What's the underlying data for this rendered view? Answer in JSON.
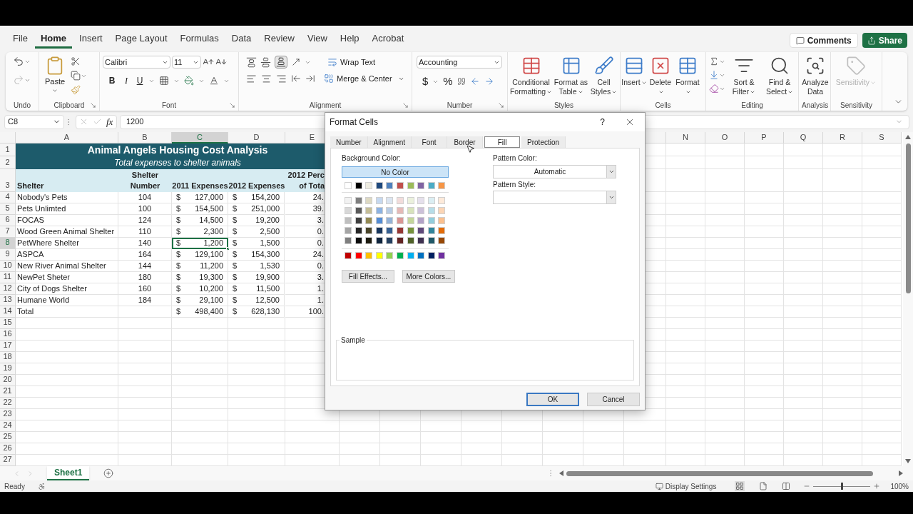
{
  "menu_tabs": [
    {
      "label": "File",
      "selected": false
    },
    {
      "label": "Home",
      "selected": true
    },
    {
      "label": "Insert",
      "selected": false
    },
    {
      "label": "Page Layout",
      "selected": false
    },
    {
      "label": "Formulas",
      "selected": false
    },
    {
      "label": "Data",
      "selected": false
    },
    {
      "label": "Review",
      "selected": false
    },
    {
      "label": "View",
      "selected": false
    },
    {
      "label": "Help",
      "selected": false
    },
    {
      "label": "Acrobat",
      "selected": false
    }
  ],
  "top_buttons": {
    "comments": "Comments",
    "share": "Share"
  },
  "ribbon": {
    "undo": {
      "label": "Undo"
    },
    "clipboard": {
      "label": "Clipboard",
      "paste": "Paste"
    },
    "font": {
      "label": "Font",
      "family": "Calibri",
      "size": "11",
      "bold": "B",
      "italic": "I",
      "underline": "U"
    },
    "alignment": {
      "label": "Alignment",
      "wrap_text": "Wrap Text",
      "merge": "Merge & Center"
    },
    "number": {
      "label": "Number",
      "format": "Accounting",
      "currency": "$",
      "percent": "%"
    },
    "styles": {
      "label": "Styles",
      "buttons": [
        {
          "kind": "conditional",
          "text": "Conditional Formatting"
        },
        {
          "kind": "table",
          "text": "Format as Table"
        },
        {
          "kind": "cellstyles",
          "text": "Cell Styles"
        }
      ]
    },
    "cells": {
      "label": "Cells",
      "buttons": [
        {
          "kind": "insert",
          "text": "Insert"
        },
        {
          "kind": "delete",
          "text": "Delete"
        },
        {
          "kind": "format",
          "text": "Format"
        }
      ]
    },
    "editing": {
      "label": "Editing",
      "buttons": [
        {
          "kind": "sort",
          "text": "Sort & Filter"
        },
        {
          "kind": "find",
          "text": "Find & Select"
        }
      ]
    },
    "analysis": {
      "label": "Analysis",
      "button": {
        "text": "Analyze Data"
      }
    },
    "sensitivity": {
      "label": "Sensitivity",
      "button": {
        "text": "Sensitivity",
        "disabled": true
      }
    }
  },
  "formula_bar": {
    "name_box": "C8",
    "function_label": "fx",
    "value": "1200"
  },
  "sheet": {
    "columns_left": [
      {
        "label": "A",
        "selected": false
      },
      {
        "label": "B",
        "selected": false
      },
      {
        "label": "C",
        "selected": true
      },
      {
        "label": "D",
        "selected": false
      },
      {
        "label": "E",
        "selected": false
      }
    ],
    "columns_right": [
      {
        "label": "N",
        "selected": false
      },
      {
        "label": "O",
        "selected": false
      },
      {
        "label": "P",
        "selected": false
      },
      {
        "label": "Q",
        "selected": false
      },
      {
        "label": "R",
        "selected": false
      },
      {
        "label": "S",
        "selected": false
      }
    ],
    "row_headers": [
      {
        "label": "1",
        "selected": false
      },
      {
        "label": "2",
        "selected": false
      },
      {
        "label": "3",
        "selected": false
      },
      {
        "label": "4",
        "selected": false
      },
      {
        "label": "5",
        "selected": false
      },
      {
        "label": "6",
        "selected": false
      },
      {
        "label": "7",
        "selected": false
      },
      {
        "label": "8",
        "selected": true
      },
      {
        "label": "9",
        "selected": false
      },
      {
        "label": "10",
        "selected": false
      },
      {
        "label": "11",
        "selected": false
      },
      {
        "label": "12",
        "selected": false
      },
      {
        "label": "13",
        "selected": false
      },
      {
        "label": "14",
        "selected": false
      },
      {
        "label": "15",
        "selected": false
      },
      {
        "label": "16",
        "selected": false
      },
      {
        "label": "17",
        "selected": false
      },
      {
        "label": "18",
        "selected": false
      },
      {
        "label": "19",
        "selected": false
      },
      {
        "label": "20",
        "selected": false
      },
      {
        "label": "21",
        "selected": false
      },
      {
        "label": "22",
        "selected": false
      },
      {
        "label": "23",
        "selected": false
      },
      {
        "label": "24",
        "selected": false
      },
      {
        "label": "25",
        "selected": false
      },
      {
        "label": "26",
        "selected": false
      },
      {
        "label": "27",
        "selected": false
      }
    ],
    "title": "Animal Angels Housing Cost Analysis",
    "subtitle": "Total expenses to shelter animals",
    "header": [
      [
        "Shelter"
      ],
      [
        "Shelter",
        "Number"
      ],
      [
        "2011 Expenses"
      ],
      [
        "2012 Expenses"
      ],
      [
        "2012 Perc",
        "of Tota"
      ]
    ],
    "rows": [
      {
        "shelter": "Nobody's Pets",
        "number": "104",
        "exp_2011": {
          "symbol": "$",
          "amount": "127,000",
          "selected": false
        },
        "exp_2012": {
          "symbol": "$",
          "amount": "154,200",
          "selected": false
        },
        "percent": "24."
      },
      {
        "shelter": "Pets Unlimted",
        "number": "100",
        "exp_2011": {
          "symbol": "$",
          "amount": "154,500",
          "selected": false
        },
        "exp_2012": {
          "symbol": "$",
          "amount": "251,000",
          "selected": false
        },
        "percent": "39."
      },
      {
        "shelter": "FOCAS",
        "number": "124",
        "exp_2011": {
          "symbol": "$",
          "amount": "14,500",
          "selected": false
        },
        "exp_2012": {
          "symbol": "$",
          "amount": "19,200",
          "selected": false
        },
        "percent": "3."
      },
      {
        "shelter": "Wood Green Animal Shelter",
        "number": "110",
        "exp_2011": {
          "symbol": "$",
          "amount": "2,300",
          "selected": false
        },
        "exp_2012": {
          "symbol": "$",
          "amount": "2,500",
          "selected": false
        },
        "percent": "0."
      },
      {
        "shelter": "PetWhere Shelter",
        "number": "140",
        "exp_2011": {
          "symbol": "$",
          "amount": "1,200",
          "selected": true
        },
        "exp_2012": {
          "symbol": "$",
          "amount": "1,500",
          "selected": false
        },
        "percent": "0."
      },
      {
        "shelter": "ASPCA",
        "number": "164",
        "exp_2011": {
          "symbol": "$",
          "amount": "129,100",
          "selected": false
        },
        "exp_2012": {
          "symbol": "$",
          "amount": "154,300",
          "selected": false
        },
        "percent": "24."
      },
      {
        "shelter": "New River Animal Shelter",
        "number": "144",
        "exp_2011": {
          "symbol": "$",
          "amount": "11,200",
          "selected": false
        },
        "exp_2012": {
          "symbol": "$",
          "amount": "1,530",
          "selected": false
        },
        "percent": "0."
      },
      {
        "shelter": "NewPet Sheter",
        "number": "180",
        "exp_2011": {
          "symbol": "$",
          "amount": "19,300",
          "selected": false
        },
        "exp_2012": {
          "symbol": "$",
          "amount": "19,900",
          "selected": false
        },
        "percent": "3."
      },
      {
        "shelter": "City of Dogs Shelter",
        "number": "160",
        "exp_2011": {
          "symbol": "$",
          "amount": "10,200",
          "selected": false
        },
        "exp_2012": {
          "symbol": "$",
          "amount": "11,500",
          "selected": false
        },
        "percent": "1."
      },
      {
        "shelter": "Humane World",
        "number": "184",
        "exp_2011": {
          "symbol": "$",
          "amount": "29,100",
          "selected": false
        },
        "exp_2012": {
          "symbol": "$",
          "amount": "12,500",
          "selected": false
        },
        "percent": "1."
      },
      {
        "shelter": "Total",
        "exp_2011": {
          "symbol": "$",
          "amount": "498,400",
          "selected": false
        },
        "exp_2012": {
          "symbol": "$",
          "amount": "628,130",
          "selected": false
        },
        "percent": "100."
      }
    ]
  },
  "sheet_tabs": [
    {
      "label": "Sheet1",
      "selected": true
    }
  ],
  "status_bar": {
    "ready": "Ready",
    "display_settings": "Display Settings",
    "zoom": {
      "level": 0.5
    },
    "zoom_label": "100%"
  },
  "dialog": {
    "title": "Format Cells",
    "help": "?",
    "tabs": [
      {
        "label": "Number",
        "selected": false
      },
      {
        "label": "Alignment",
        "selected": false
      },
      {
        "label": "Font",
        "selected": false
      },
      {
        "label": "Border",
        "selected": false
      },
      {
        "label": "Fill",
        "selected": true
      },
      {
        "label": "Protection",
        "selected": false
      }
    ],
    "background_label": "Background Color:",
    "no_color": {
      "label": "No Color",
      "selected": true
    },
    "theme_colors": [
      {
        "color": "#ffffff",
        "selected": false
      },
      {
        "color": "#000000",
        "selected": false
      },
      {
        "color": "#eeece1",
        "selected": false
      },
      {
        "color": "#1f497d",
        "selected": false
      },
      {
        "color": "#4f81bd",
        "selected": false
      },
      {
        "color": "#c0504d",
        "selected": false
      },
      {
        "color": "#9bbb59",
        "selected": false
      },
      {
        "color": "#8064a2",
        "selected": false
      },
      {
        "color": "#4bacc6",
        "selected": false
      },
      {
        "color": "#f79646",
        "selected": false
      }
    ],
    "tint_rows": [
      [
        {
          "color": "#f2f2f2",
          "selected": false
        },
        {
          "color": "#7f7f7f",
          "selected": false
        },
        {
          "color": "#ddd9c3",
          "selected": false
        },
        {
          "color": "#c6d9f0",
          "selected": false
        },
        {
          "color": "#dbe5f1",
          "selected": false
        },
        {
          "color": "#f2dcdb",
          "selected": false
        },
        {
          "color": "#ebf1dd",
          "selected": false
        },
        {
          "color": "#e5e0ec",
          "selected": false
        },
        {
          "color": "#dbeef3",
          "selected": false
        },
        {
          "color": "#fdeada",
          "selected": false
        }
      ],
      [
        {
          "color": "#d8d8d8",
          "selected": false
        },
        {
          "color": "#595959",
          "selected": false
        },
        {
          "color": "#c4bd97",
          "selected": false
        },
        {
          "color": "#8db3e2",
          "selected": false
        },
        {
          "color": "#b8cce4",
          "selected": false
        },
        {
          "color": "#e5b9b7",
          "selected": false
        },
        {
          "color": "#d7e3bc",
          "selected": false
        },
        {
          "color": "#ccc1d9",
          "selected": false
        },
        {
          "color": "#b7dde8",
          "selected": false
        },
        {
          "color": "#fbd5b5",
          "selected": false
        }
      ],
      [
        {
          "color": "#bfbfbf",
          "selected": false
        },
        {
          "color": "#3f3f3f",
          "selected": false
        },
        {
          "color": "#938953",
          "selected": false
        },
        {
          "color": "#548dd4",
          "selected": false
        },
        {
          "color": "#95b3d7",
          "selected": false
        },
        {
          "color": "#d99694",
          "selected": false
        },
        {
          "color": "#c3d69b",
          "selected": false
        },
        {
          "color": "#b2a2c7",
          "selected": false
        },
        {
          "color": "#92cddc",
          "selected": false
        },
        {
          "color": "#fac08f",
          "selected": false
        }
      ],
      [
        {
          "color": "#a5a5a5",
          "selected": false
        },
        {
          "color": "#262626",
          "selected": false
        },
        {
          "color": "#494429",
          "selected": false
        },
        {
          "color": "#17365d",
          "selected": false
        },
        {
          "color": "#366092",
          "selected": false
        },
        {
          "color": "#953734",
          "selected": false
        },
        {
          "color": "#76923c",
          "selected": false
        },
        {
          "color": "#5f497a",
          "selected": false
        },
        {
          "color": "#31859b",
          "selected": false
        },
        {
          "color": "#e36c09",
          "selected": false
        }
      ],
      [
        {
          "color": "#7f7f7f",
          "selected": false
        },
        {
          "color": "#0c0c0c",
          "selected": false
        },
        {
          "color": "#1d1b10",
          "selected": false
        },
        {
          "color": "#0f243e",
          "selected": false
        },
        {
          "color": "#244061",
          "selected": false
        },
        {
          "color": "#632423",
          "selected": false
        },
        {
          "color": "#4f6128",
          "selected": false
        },
        {
          "color": "#3f3151",
          "selected": false
        },
        {
          "color": "#205867",
          "selected": false
        },
        {
          "color": "#974806",
          "selected": false
        }
      ]
    ],
    "standard_colors": [
      {
        "color": "#c00000",
        "selected": false
      },
      {
        "color": "#ff0000",
        "selected": false
      },
      {
        "color": "#ffc000",
        "selected": false
      },
      {
        "color": "#ffff00",
        "selected": false
      },
      {
        "color": "#92d050",
        "selected": false
      },
      {
        "color": "#00b050",
        "selected": false
      },
      {
        "color": "#00b0f0",
        "selected": false
      },
      {
        "color": "#0070c0",
        "selected": false
      },
      {
        "color": "#002060",
        "selected": false
      },
      {
        "color": "#7030a0",
        "selected": false
      }
    ],
    "fill_effects": "Fill Effects...",
    "more_colors": "More Colors...",
    "pattern_color_label": "Pattern Color:",
    "pattern_color": "Automatic",
    "pattern_style_label": "Pattern Style:",
    "sample_label": "Sample",
    "ok": "OK",
    "cancel": "Cancel"
  }
}
